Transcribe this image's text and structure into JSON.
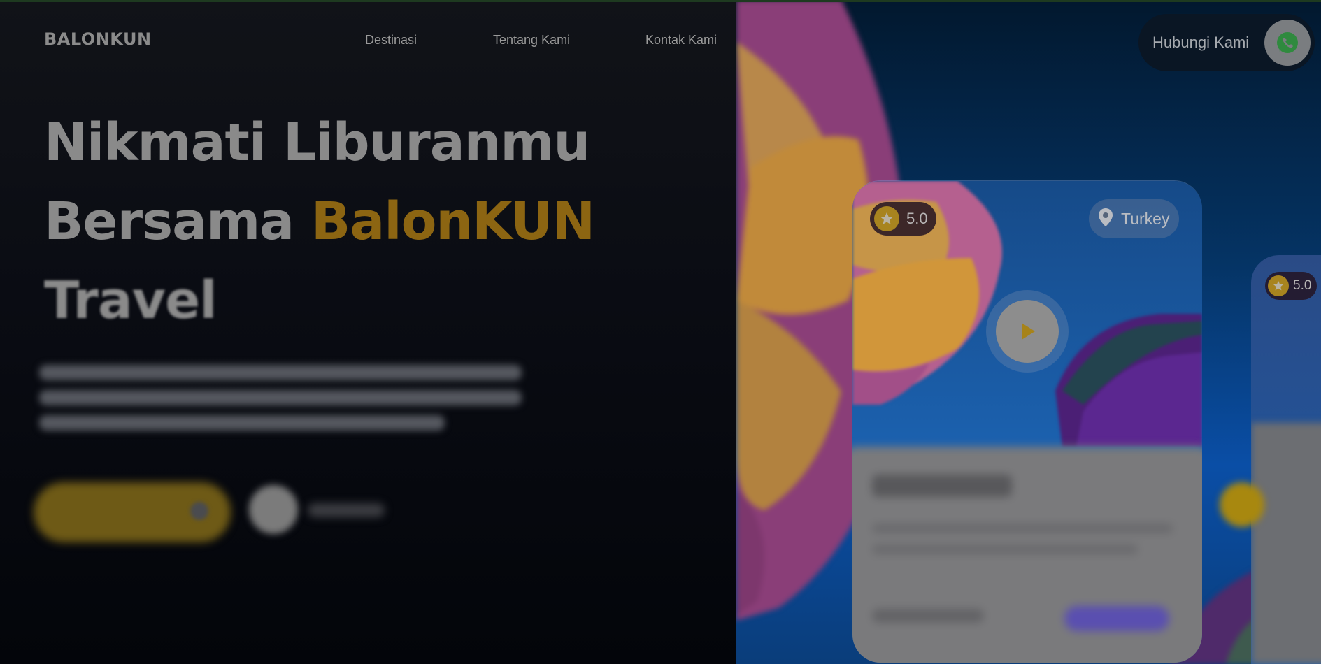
{
  "brand": {
    "logo": "BALONKUN"
  },
  "nav": {
    "items": [
      "Destinasi",
      "Tentang Kami",
      "Kontak Kami"
    ]
  },
  "contact": {
    "label": "Hubungi Kami",
    "icon": "whatsapp-icon"
  },
  "hero": {
    "line1": "Nikmati Liburanmu",
    "line2_prefix": "Bersama ",
    "line2_accent": "BalonKUN",
    "line3": "Travel",
    "accent_color": "#8c6512"
  },
  "featured_card": {
    "rating": "5.0",
    "location": "Turkey"
  },
  "second_card": {
    "rating": "5.0"
  }
}
